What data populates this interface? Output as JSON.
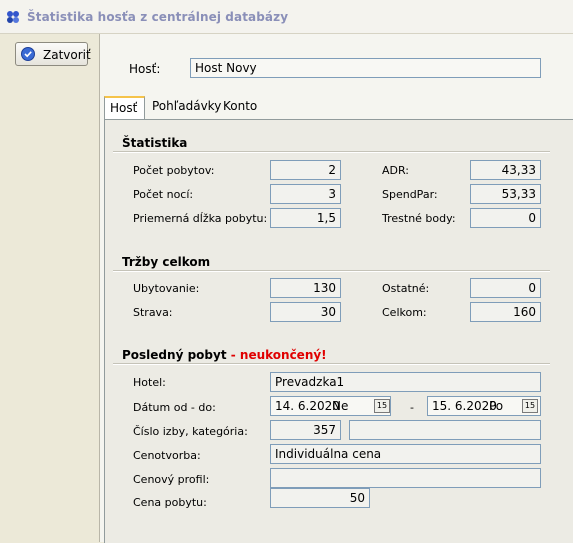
{
  "window": {
    "title": "Štatistika hosťa z centrálnej databázy"
  },
  "toolbar": {
    "close_label": "Zatvoriť"
  },
  "guest": {
    "label": "Hosť:",
    "value": "Host Novy"
  },
  "tabs": [
    {
      "label": "Hosť",
      "active": true
    },
    {
      "label": "Pohľadávky",
      "active": false
    },
    {
      "label": "Konto",
      "active": false
    }
  ],
  "stats": {
    "heading": "Štatistika",
    "stays_label": "Počet pobytov:",
    "stays": "2",
    "nights_label": "Počet nocí:",
    "nights": "3",
    "avg_label": "Priemerná dĺžka pobytu:",
    "avg": "1,5",
    "adr_label": "ADR:",
    "adr": "43,33",
    "spend_label": "SpendPar:",
    "spend": "53,33",
    "penalty_label": "Trestné body:",
    "penalty": "0"
  },
  "revenue": {
    "heading": "Tržby celkom",
    "accom_label": "Ubytovanie:",
    "accom": "130",
    "food_label": "Strava:",
    "food": "30",
    "other_label": "Ostatné:",
    "other": "0",
    "total_label": "Celkom:",
    "total": "160"
  },
  "last_stay": {
    "heading": "Posledný pobyt",
    "status": " - neukončený!",
    "hotel_label": "Hotel:",
    "hotel": "Prevadzka1",
    "date_label": "Dátum od - do:",
    "date_from": "14. 6.2020",
    "day_from": "Ne",
    "date_sep": "-",
    "date_to": "15. 6.2020",
    "day_to": "Po",
    "room_label": "Číslo izby, kategória:",
    "room": "357",
    "category": "",
    "pricing_label": "Cenotvorba:",
    "pricing": "Individuálna cena",
    "profile_label": "Cenový profil:",
    "profile": "",
    "price_label": "Cena pobytu:",
    "price": "50"
  },
  "colors": {
    "accent": "#f5c34a",
    "warning": "#e00000",
    "title": "#8a8fb8"
  },
  "icons": {
    "app": "app-icon",
    "close": "close-check-icon",
    "calendar": "calendar-icon"
  }
}
